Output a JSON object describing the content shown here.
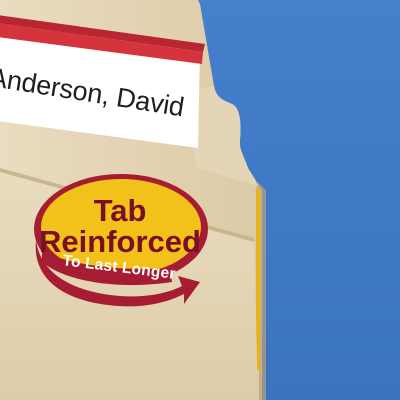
{
  "folder_label": {
    "name_text": "Anderson, David"
  },
  "badge": {
    "line1": "Tab",
    "line2": "Reinforced",
    "line3": "To Last Longer"
  },
  "colors": {
    "background": "#3f78c4",
    "folder": "#e9dcbf",
    "label_stripe": "#d6343c",
    "badge_fill": "#f2c21a",
    "badge_ring": "#a51c33",
    "badge_text": "#7a0f24"
  }
}
